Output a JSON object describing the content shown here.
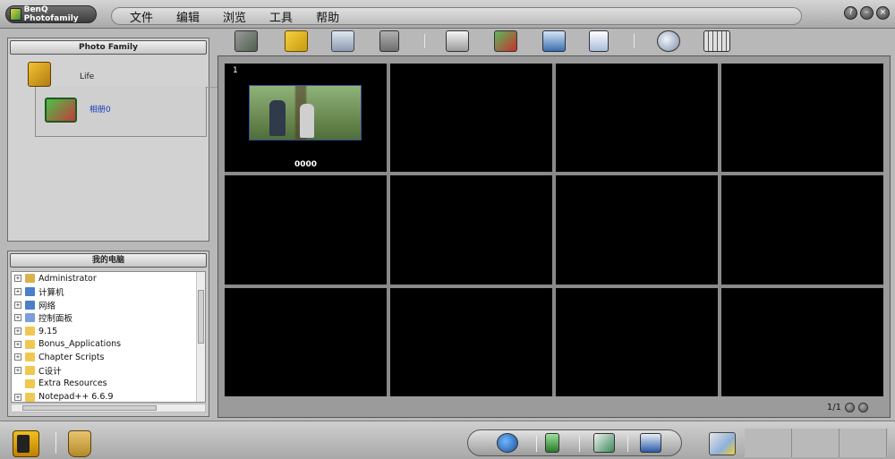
{
  "app": {
    "title": "BenQ Photofamily"
  },
  "menu": [
    "文件",
    "编辑",
    "浏览",
    "工具",
    "帮助"
  ],
  "window_buttons": [
    "?",
    "–",
    "×"
  ],
  "toolbar": {
    "buttons": [
      "photo-stack-icon",
      "open-folder-icon",
      "scanner-icon",
      "film-save-icon",
      "printer-icon",
      "image-edit-icon",
      "preview-eye-icon",
      "document-icon",
      "search-magnifier-icon",
      "view-layout-icon"
    ]
  },
  "album_panel": {
    "header": "Photo Family",
    "group_label": "Life",
    "album_label": "相册0"
  },
  "computer_panel": {
    "header": "我的电脑",
    "items": [
      {
        "label": "Administrator",
        "expander": "+",
        "icon": "user-folder-icon",
        "color": "#d9b24a"
      },
      {
        "label": "计算机",
        "expander": "+",
        "icon": "computer-icon",
        "color": "#4a7fc9"
      },
      {
        "label": "网络",
        "expander": "+",
        "icon": "network-icon",
        "color": "#4a7fc9"
      },
      {
        "label": "控制面板",
        "expander": "+",
        "icon": "control-panel-icon",
        "color": "#7a9fd9"
      },
      {
        "label": "9.15",
        "expander": "+",
        "icon": "folder-icon",
        "color": "#f0c850"
      },
      {
        "label": "Bonus_Applications",
        "expander": "+",
        "icon": "folder-icon",
        "color": "#f0c850"
      },
      {
        "label": "Chapter Scripts",
        "expander": "+",
        "icon": "folder-icon",
        "color": "#f0c850"
      },
      {
        "label": "C设计",
        "expander": "+",
        "icon": "folder-icon",
        "color": "#f0c850"
      },
      {
        "label": "Extra Resources",
        "expander": "",
        "icon": "folder-icon",
        "color": "#f0c850"
      },
      {
        "label": "Notepad++ 6.6.9",
        "expander": "+",
        "icon": "folder-icon",
        "color": "#f0c850"
      }
    ]
  },
  "grid": {
    "first_index": "1",
    "first_caption": "0000",
    "status": "1/1"
  },
  "bottom": {
    "actions": [
      "globe-send-icon",
      "phone-icon",
      "email-photo-icon",
      "calendar-icon"
    ]
  }
}
